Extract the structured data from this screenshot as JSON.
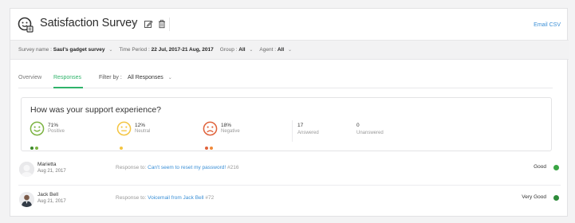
{
  "header": {
    "title": "Satisfaction Survey",
    "title_caret": "▾",
    "email_csv": "Email CSV"
  },
  "filters": {
    "survey_name_label": "Survey name :",
    "survey_name_value": "Saul's gadget survey",
    "time_period_label": "Time Period :",
    "time_period_value": "22 Jul, 2017-21 Aug, 2017",
    "group_label": "Group :",
    "group_value": "All",
    "agent_label": "Agent :",
    "agent_value": "All",
    "caret": "⌄"
  },
  "tabs": {
    "overview": "Overview",
    "responses": "Responses",
    "filter_by_label": "Filter by :",
    "filter_by_value": "All Responses",
    "caret": "⌄"
  },
  "question_card": {
    "question": "How was your support experience?",
    "positive": {
      "pct": "71%",
      "label": "Positive",
      "color": "#7cb342",
      "dots": 2
    },
    "neutral": {
      "pct": "12%",
      "label": "Neutral",
      "color": "#f4c542",
      "dots": 1
    },
    "negative": {
      "pct": "18%",
      "label": "Negative",
      "color": "#e0623b",
      "dots": 2
    },
    "answered": {
      "count": "17",
      "label": "Answered"
    },
    "unanswered": {
      "count": "0",
      "label": "Unanswered"
    }
  },
  "responses": [
    {
      "name": "Marietta",
      "date": "Aug 21, 2017",
      "response_prefix": "Response to:",
      "ticket_link": "Can't seem to reset my password!",
      "ticket_id": "#216",
      "rating": "Good",
      "rating_color": "#3aa544"
    },
    {
      "name": "Jack Bell",
      "date": "Aug 21, 2017",
      "response_prefix": "Response to:",
      "ticket_link": "Voicemail from Jack Bell",
      "ticket_id": "#72",
      "rating": "Very Good",
      "rating_color": "#2e8b3a"
    }
  ],
  "icons": {
    "logo": "survey-face-icon",
    "edit": "edit-icon",
    "delete": "trash-icon",
    "positive": "smile-icon",
    "neutral": "neutral-face-icon",
    "negative": "frown-icon"
  }
}
